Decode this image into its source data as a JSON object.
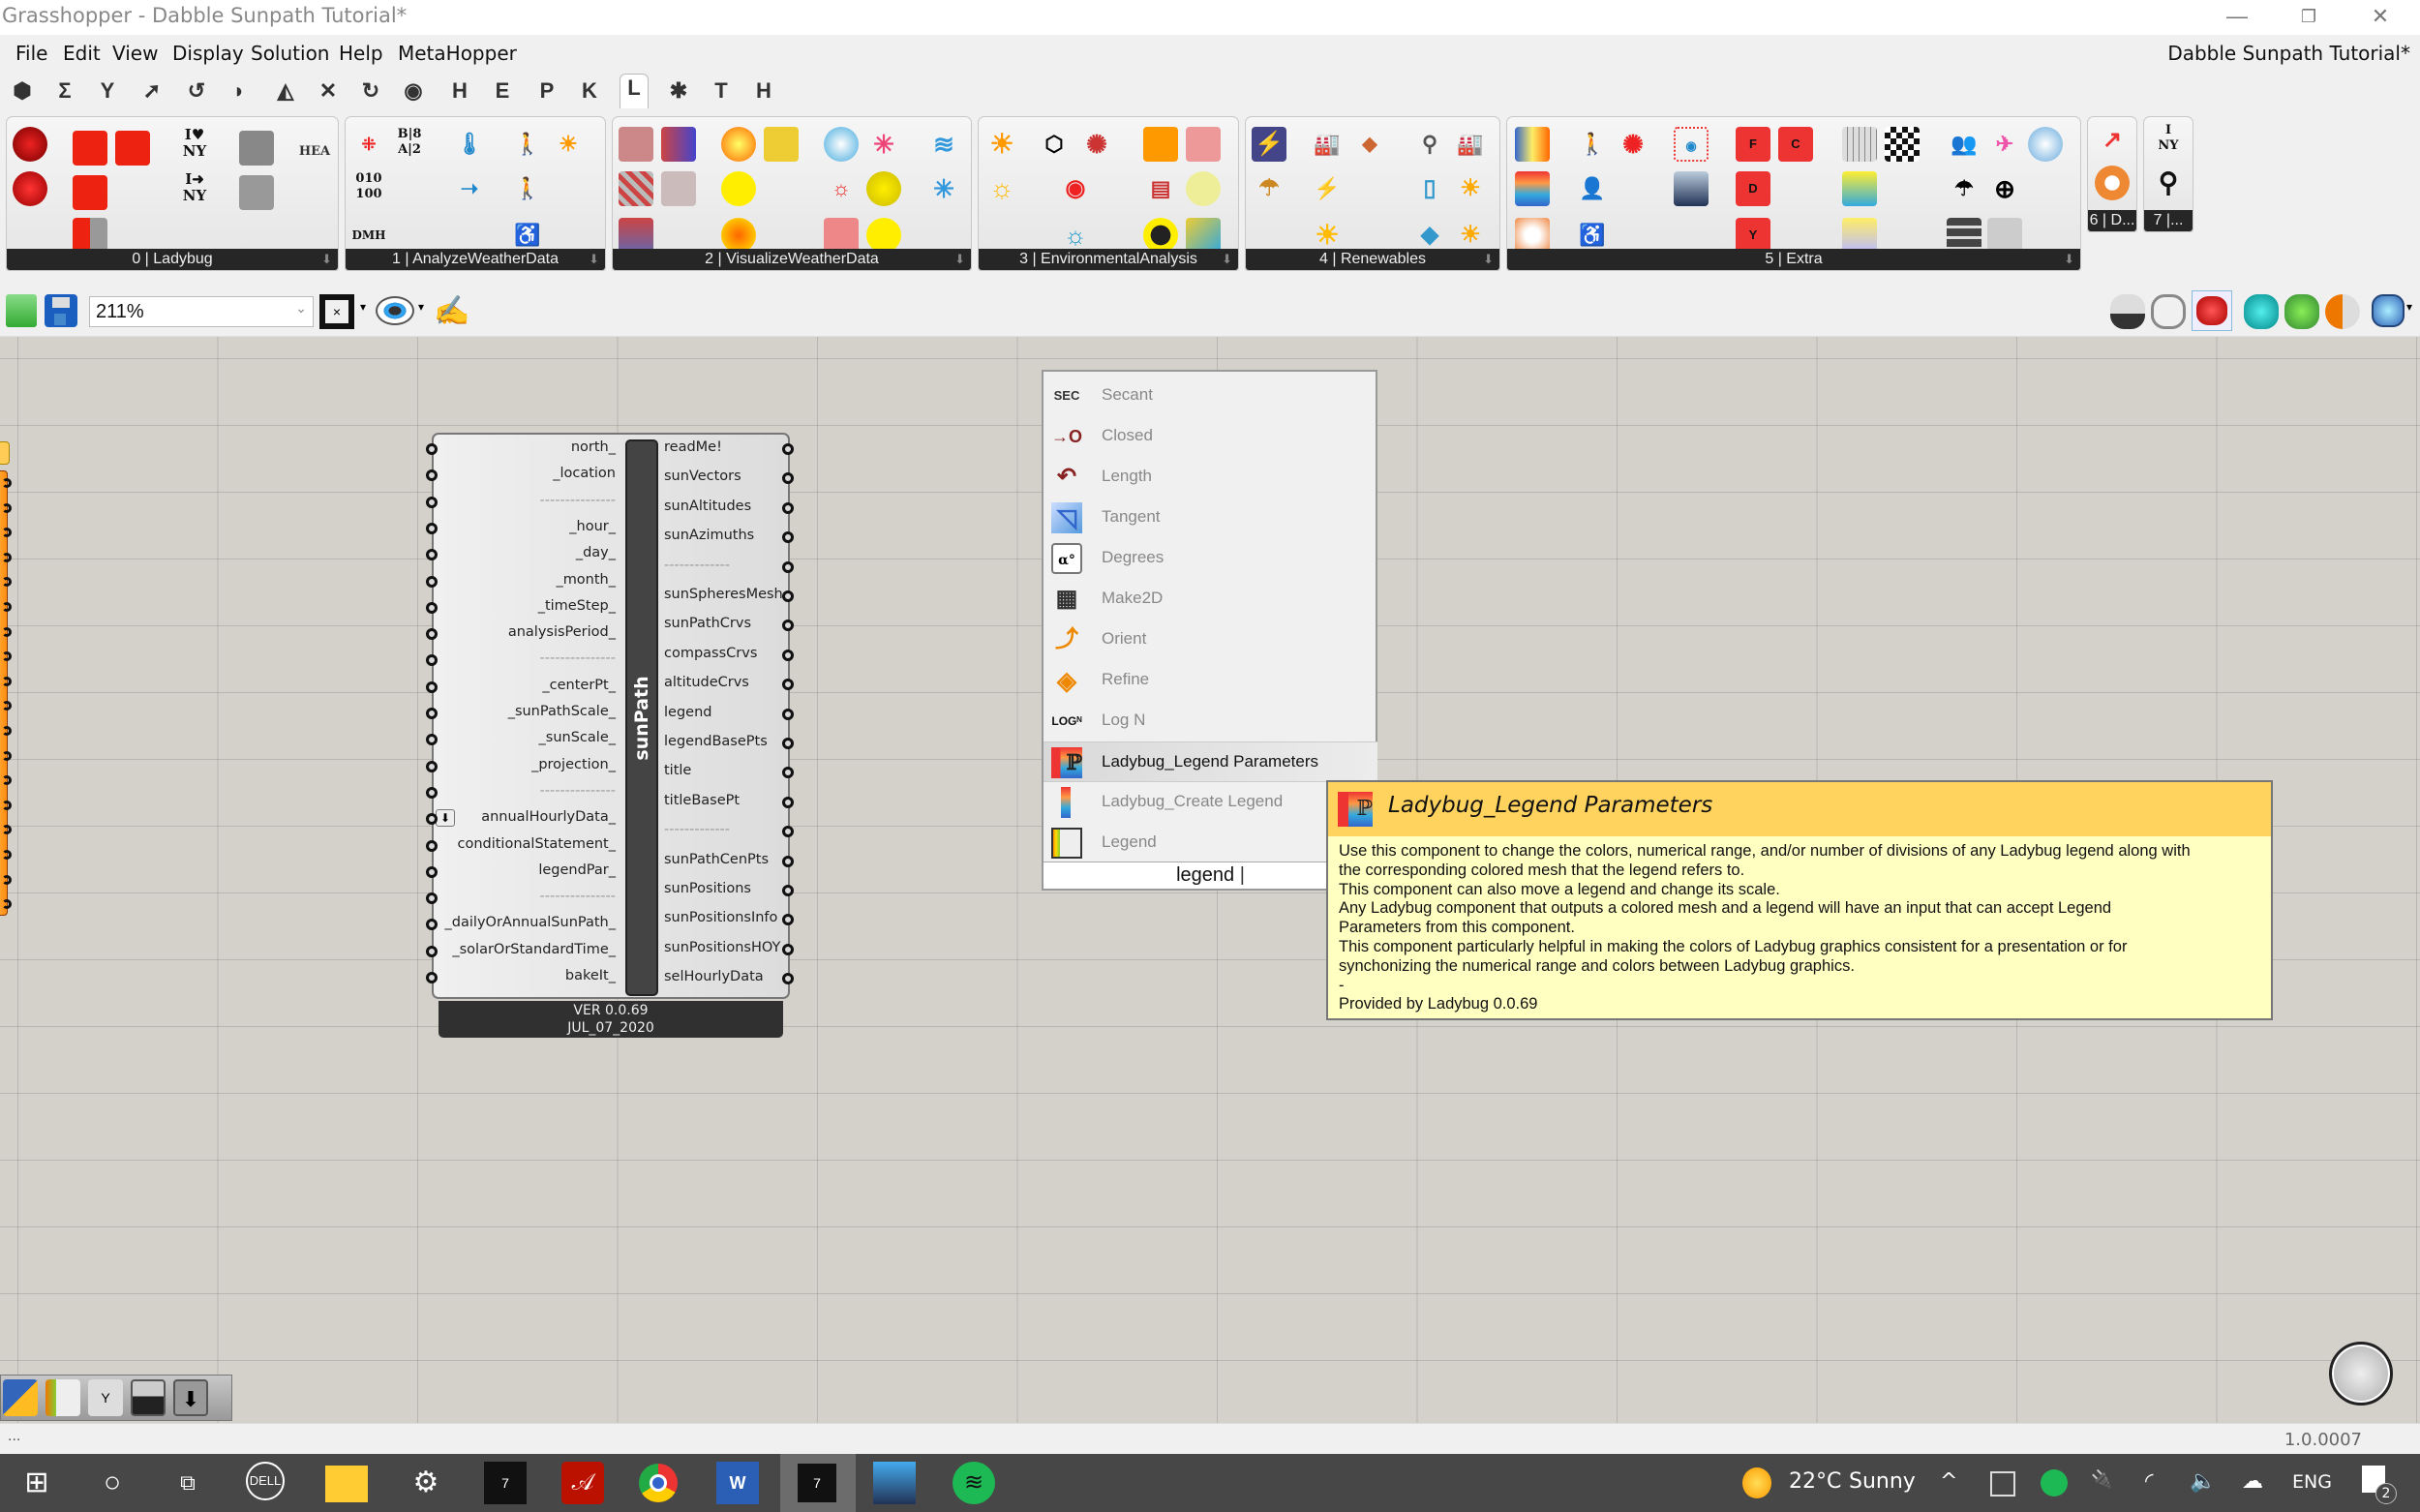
{
  "window": {
    "title": "Grasshopper - Dabble Sunpath Tutorial*",
    "document_name": "Dabble Sunpath Tutorial*",
    "controls": {
      "minimize": "—",
      "restore": "❐",
      "close": "✕"
    }
  },
  "menu": [
    "File",
    "Edit",
    "View",
    "Display",
    "Solution",
    "Help",
    "MetaHopper"
  ],
  "tabs": [
    {
      "icon": "params-icon",
      "glyph": "⬢"
    },
    {
      "icon": "maths-icon",
      "glyph": "Σ"
    },
    {
      "icon": "sets-icon",
      "glyph": "Y"
    },
    {
      "icon": "vector-icon",
      "glyph": "➚"
    },
    {
      "icon": "curve-icon",
      "glyph": "↺"
    },
    {
      "icon": "surface-icon",
      "glyph": "◗"
    },
    {
      "icon": "mesh-icon",
      "glyph": "◭"
    },
    {
      "icon": "intersect-icon",
      "glyph": "✕"
    },
    {
      "icon": "transform-icon",
      "glyph": "↻"
    },
    {
      "icon": "display-icon",
      "glyph": "◉"
    },
    {
      "icon": "tab-h",
      "glyph": "H"
    },
    {
      "icon": "tab-e",
      "glyph": "E"
    },
    {
      "icon": "tab-p",
      "glyph": "P"
    },
    {
      "icon": "tab-k",
      "glyph": "K"
    },
    {
      "icon": "tab-l",
      "glyph": "L",
      "active": true
    },
    {
      "icon": "grasshopper-icon",
      "glyph": "✱"
    },
    {
      "icon": "tab-t",
      "glyph": "T"
    },
    {
      "icon": "tab-h2",
      "glyph": "H"
    }
  ],
  "ribbon_panels": [
    {
      "label": "0 | Ladybug"
    },
    {
      "label": "1 | AnalyzeWeatherData"
    },
    {
      "label": "2 | VisualizeWeatherData"
    },
    {
      "label": "3 | EnvironmentalAnalysis"
    },
    {
      "label": "4 | Renewables"
    },
    {
      "label": "5 | Extra"
    },
    {
      "label": "6 | D..."
    },
    {
      "label": "7 |..."
    }
  ],
  "ribbon_icon_texts": {
    "hea": "HEA",
    "ny1": "I♥\nNY",
    "ny2": "I➜\nNY",
    "bsa": "B|8\nA|2",
    "bin": "010\n100",
    "dmh": "DMH",
    "nyq": "I\nNY"
  },
  "canvas_toolbar": {
    "zoom_value": "211%",
    "zoom_dropdown": "⌄"
  },
  "component": {
    "nickname": "sunPath",
    "inputs": [
      "north_",
      "_location",
      "---------------",
      "_hour_",
      "_day_",
      "_month_",
      "_timeStep_",
      "analysisPeriod_",
      "---------------",
      "_centerPt_",
      "_sunPathScale_",
      "_sunScale_",
      "_projection_",
      "---------------",
      "annualHourlyData_",
      "conditionalStatement_",
      "legendPar_",
      "---------------",
      "_dailyOrAnnualSunPath_",
      "_solarOrStandardTime_",
      "bakeIt_"
    ],
    "outputs": [
      "readMe!",
      "sunVectors",
      "sunAltitudes",
      "sunAzimuths",
      "-------------",
      "sunSpheresMesh",
      "sunPathCrvs",
      "compassCrvs",
      "altitudeCrvs",
      "legend",
      "legendBasePts",
      "title",
      "titleBasePt",
      "-------------",
      "sunPathCenPts",
      "sunPositions",
      "sunPositionsInfo",
      "sunPositionsHOY",
      "selHourlyData"
    ],
    "version": "VER 0.0.69",
    "date": "JUL_07_2020"
  },
  "search": {
    "results": [
      {
        "label": "Secant",
        "icon": "secant-icon",
        "glyph": "SEC"
      },
      {
        "label": "Closed",
        "icon": "closed-curve-icon",
        "glyph": "→O"
      },
      {
        "label": "Length",
        "icon": "length-icon",
        "glyph": "↶"
      },
      {
        "label": "Tangent",
        "icon": "tangent-icon",
        "glyph": "◹"
      },
      {
        "label": "Degrees",
        "icon": "degrees-icon",
        "glyph": "α°"
      },
      {
        "label": "Make2D",
        "icon": "make2d-icon",
        "glyph": "▦"
      },
      {
        "label": "Orient",
        "icon": "orient-icon",
        "glyph": "⤴"
      },
      {
        "label": "Refine",
        "icon": "refine-icon",
        "glyph": "◈"
      },
      {
        "label": "Log N",
        "icon": "log-n-icon",
        "glyph": "LOGᴺ"
      },
      {
        "label": "Ladybug_Legend Parameters",
        "icon": "legend-parameters-icon",
        "glyph": "ℙ",
        "selected": true
      },
      {
        "label": "Ladybug_Create Legend",
        "icon": "create-legend-icon",
        "glyph": "▮"
      },
      {
        "label": "Legend",
        "icon": "legend-icon",
        "glyph": "▤"
      }
    ],
    "query": "legend"
  },
  "tooltip": {
    "title": "Ladybug_Legend Parameters",
    "lines": [
      "Use this component to change the colors, numerical range, and/or number of divisions of any Ladybug legend along with",
      "the corresponding colored mesh that the legend refers to.",
      "This component can also move a legend and change its scale.",
      "Any Ladybug component that outputs a colored mesh and a legend will have an input that can accept Legend",
      "Parameters from this component.",
      "This component particularly helpful in making the colors of Ladybug graphics consistent for a presentation or for",
      "synchonizing the numerical range and colors between Ladybug graphics.",
      "-",
      "Provided by Ladybug 0.0.69"
    ]
  },
  "status": {
    "left": "...",
    "version": "1.0.0007"
  },
  "taskbar": {
    "weather_temp": "22°C",
    "weather_desc": "Sunny",
    "language": "ENG",
    "notifications": "2",
    "tray_up": "^"
  }
}
